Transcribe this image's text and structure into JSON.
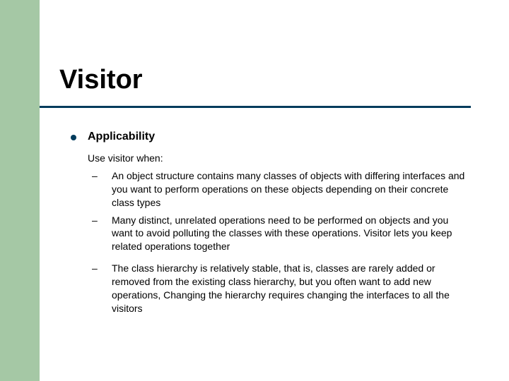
{
  "title": "Visitor",
  "heading": "Applicability",
  "intro": "Use visitor when:",
  "dash": "–",
  "items": [
    "An object structure contains many classes of objects with differing interfaces and you want to perform operations on these objects depending on their concrete class types",
    "Many distinct, unrelated operations need to be performed on objects and you want to avoid polluting the classes with these operations.  Visitor lets you keep related operations together",
    "The class hierarchy is relatively stable, that is, classes are rarely added or removed from the existing class hierarchy, but you often want to add new operations,  Changing the hierarchy requires changing the interfaces to all the visitors"
  ]
}
